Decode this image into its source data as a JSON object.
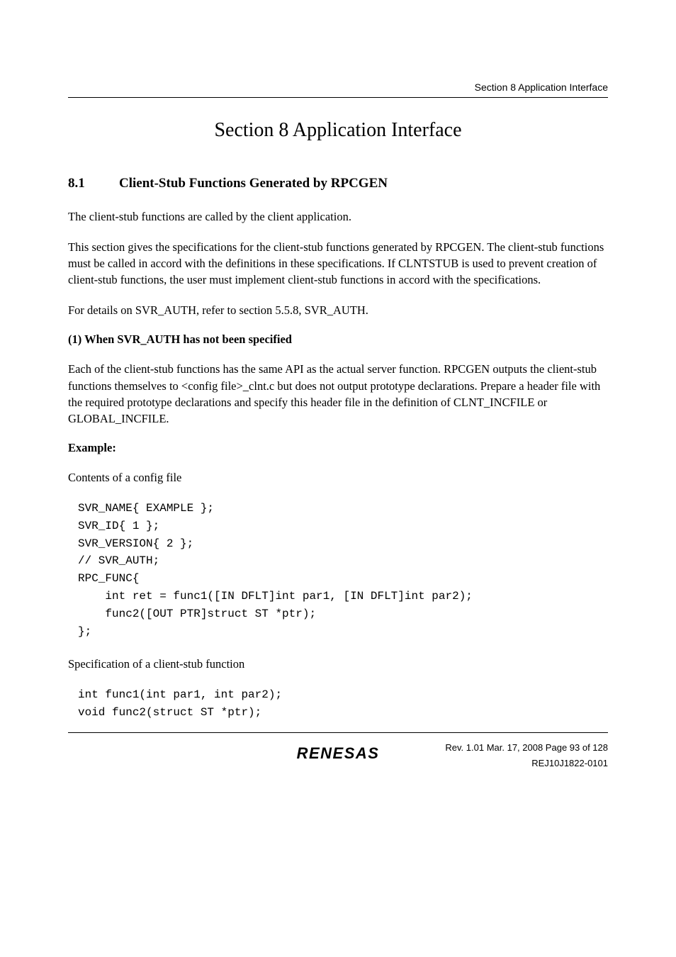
{
  "header": {
    "right_text": "Section 8   Application Interface"
  },
  "section": {
    "title": "Section 8   Application Interface"
  },
  "subsection": {
    "number": "8.1",
    "title": "Client-Stub Functions Generated by RPCGEN"
  },
  "paragraphs": {
    "p1": "The client-stub functions are called by the client application.",
    "p2": "This section gives the specifications for the client-stub functions generated by RPCGEN. The client-stub functions must be called in accord with the definitions in these specifications. If CLNTSTUB is used to prevent creation of client-stub functions, the user must implement client-stub functions in accord with the specifications.",
    "p3": "For details on SVR_AUTH, refer to section 5.5.8, SVR_AUTH.",
    "heading1": "(1) When SVR_AUTH has not been specified",
    "p4": "Each of the client-stub functions has the same API as the actual server function. RPCGEN outputs the client-stub functions themselves to <config file>_clnt.c but does not output prototype declarations. Prepare a header file with the required prototype declarations and specify this header file in the definition of CLNT_INCFILE or GLOBAL_INCFILE.",
    "example_label": "Example:",
    "p5": "Contents of a config file",
    "code1": "SVR_NAME{ EXAMPLE };\nSVR_ID{ 1 };\nSVR_VERSION{ 2 };\n// SVR_AUTH;\nRPC_FUNC{\n    int ret = func1([IN DFLT]int par1, [IN DFLT]int par2);\n    func2([OUT PTR]struct ST *ptr);\n};",
    "p6": "Specification of a client-stub function",
    "code2": "int func1(int par1, int par2);\nvoid func2(struct ST *ptr);"
  },
  "footer": {
    "logo": "RENESAS",
    "line1": "Rev. 1.01  Mar. 17, 2008  Page 93 of 128",
    "line2": "REJ10J1822-0101"
  }
}
